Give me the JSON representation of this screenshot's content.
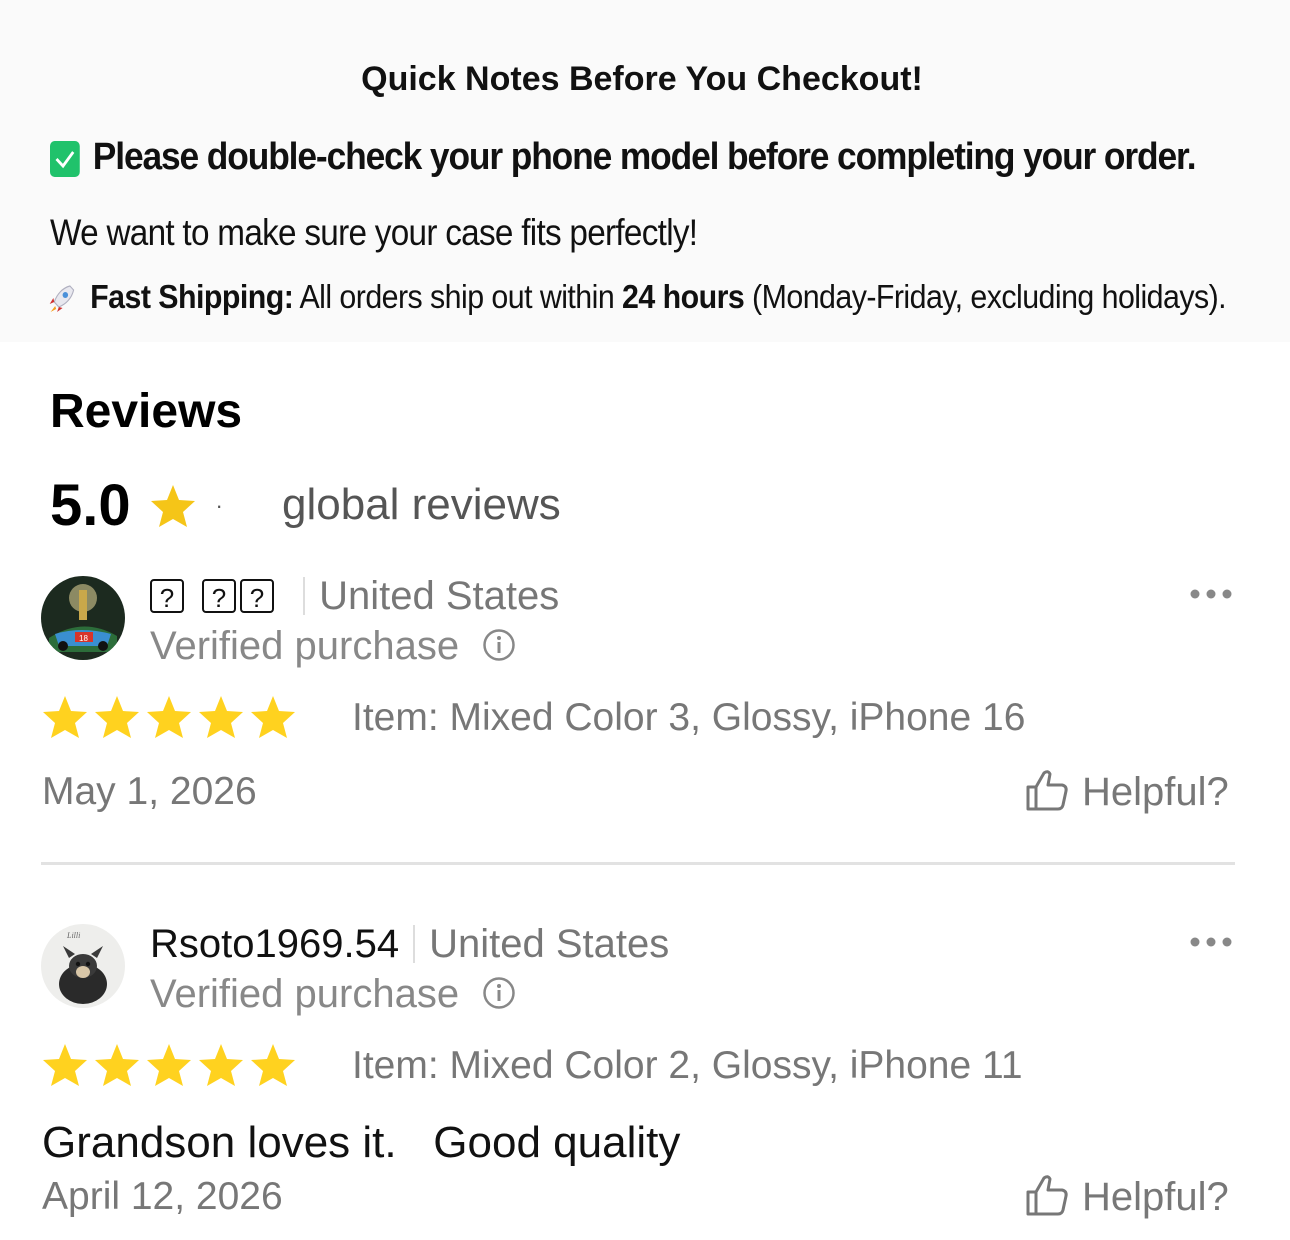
{
  "notes": {
    "title": "Quick Notes Before You Checkout!",
    "check_line": "Please double-check your phone model before completing your order.",
    "fit_line": "We want to make sure your case fits perfectly!",
    "shipping_label": "Fast Shipping:",
    "shipping_text_a": " All orders ship out within ",
    "shipping_hours": "24 hours",
    "shipping_text_b": " (Monday-Friday, excluding holidays)."
  },
  "reviews_section": {
    "heading": "Reviews",
    "average_rating": "5.0",
    "dot": "·",
    "global_label": "global reviews",
    "star_color": "#f5c518"
  },
  "reviews": [
    {
      "username_glyphs": [
        "?",
        "?",
        "?"
      ],
      "country": "United States",
      "verified": "Verified purchase",
      "rating": 5,
      "item": "Item: Mixed Color 3, Glossy, iPhone 16",
      "text": "",
      "date": "May 1, 2026",
      "helpful_label": "Helpful?"
    },
    {
      "username": "Rsoto1969.54",
      "country": "United States",
      "verified": "Verified purchase",
      "rating": 5,
      "item": "Item: Mixed Color 2, Glossy, iPhone 11",
      "text": "Grandson loves it.   Good quality",
      "date": "April 12, 2026",
      "helpful_label": "Helpful?"
    }
  ],
  "icons": {
    "check": "green-check-icon",
    "rocket": "rocket-icon",
    "star": "star-icon",
    "info": "info-icon",
    "more": "more-dots-icon",
    "thumbs_up": "thumbs-up-icon"
  }
}
